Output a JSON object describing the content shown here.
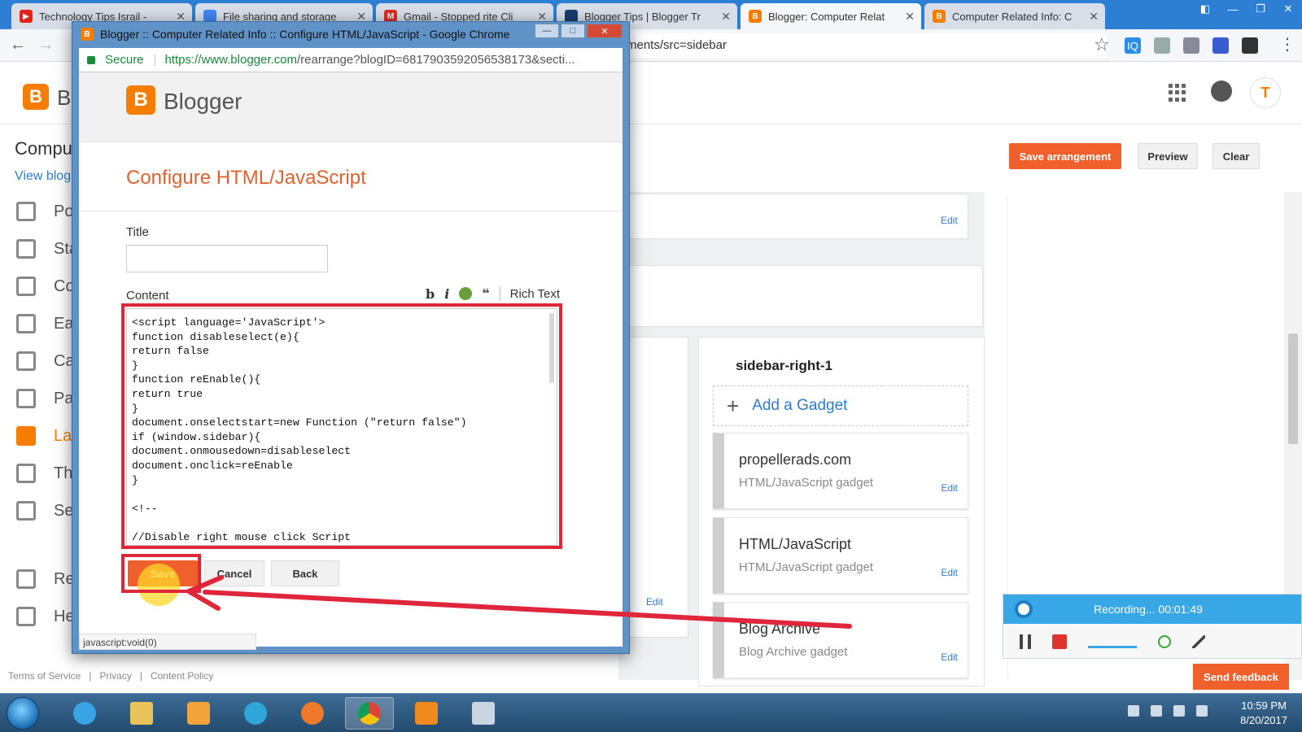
{
  "browser": {
    "tabs": [
      {
        "title": "Technology Tips Israil -",
        "fav_color": "#e62117"
      },
      {
        "title": "File sharing and storage",
        "fav_color": "#4285f4"
      },
      {
        "title": "Gmail - Stopped rite Cli",
        "fav_color": "#d93025"
      },
      {
        "title": "Blogger Tips | Blogger Tr",
        "fav_color": "#1a3d6d"
      },
      {
        "title": "Blogger: Computer Relat",
        "fav_color": "#f57d00"
      },
      {
        "title": "Computer Related Info: C",
        "fav_color": "#f57d00"
      }
    ],
    "address_visible": "ments/src=sidebar"
  },
  "blogger_bg": {
    "logo_text": "B",
    "blog_title": "Compu",
    "view_blog": "View blog",
    "nav": [
      "Po",
      "Sta",
      "Co",
      "Ea",
      "Ca",
      "Pa",
      "La",
      "Th",
      "Se",
      "Re",
      "He"
    ],
    "save_arrangement": "Save arrangement",
    "preview": "Preview",
    "clear": "Clear",
    "edit": "Edit",
    "sidebar_section_title": "sidebar-right-1",
    "add_gadget": "Add a Gadget",
    "gadgets": [
      {
        "title": "propellerads.com",
        "subtitle": "HTML/JavaScript gadget"
      },
      {
        "title": "HTML/JavaScript",
        "subtitle": "HTML/JavaScript gadget"
      },
      {
        "title": "Blog Archive",
        "subtitle": "Blog Archive gadget"
      }
    ],
    "footer": [
      "Terms of Service",
      "Privacy",
      "Content Policy"
    ]
  },
  "popup": {
    "window_title": "Blogger :: Computer Related Info :: Configure HTML/JavaScript - Google Chrome",
    "secure_label": "Secure",
    "url_host": "https://www.blogger.com",
    "url_path": "/rearrange?blogID=6817903592056538173&secti...",
    "brand": "Blogger",
    "heading": "Configure HTML/JavaScript",
    "title_label": "Title",
    "title_value": "",
    "content_label": "Content",
    "rich_text": "Rich Text",
    "content_code": "<script language='JavaScript'>\nfunction disableselect(e){\nreturn false\n}\nfunction reEnable(){\nreturn true\n}\ndocument.onselectstart=new Function (\"return false\")\nif (window.sidebar){\ndocument.onmousedown=disableselect\ndocument.onclick=reEnable\n}\n\n<!--\n\n//Disable right mouse click Script",
    "save": "Save",
    "cancel": "Cancel",
    "back": "Back",
    "status": "javascript:void(0)"
  },
  "recorder": {
    "status": "Recording... 00:01:49",
    "send_feedback": "Send feedback"
  },
  "taskbar": {
    "time": "10:59 PM",
    "date": "8/20/2017"
  },
  "colors": {
    "accent": "#f0602d",
    "highlight": "#e0263a",
    "link": "#2b7cd3"
  }
}
